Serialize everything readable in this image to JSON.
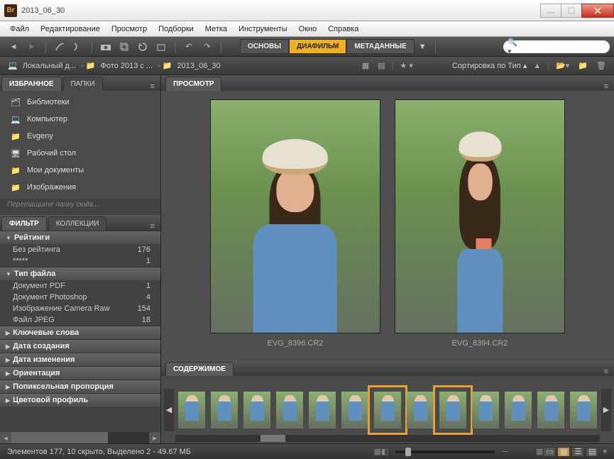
{
  "window": {
    "title": "2013_06_30"
  },
  "menu": [
    "Файл",
    "Редактирование",
    "Просмотр",
    "Подборки",
    "Метка",
    "Инструменты",
    "Окно",
    "Справка"
  ],
  "workspace": {
    "tabs": [
      "ОСНОВЫ",
      "ДИАФИЛЬМ",
      "МЕТАДАННЫЕ"
    ],
    "active": 1
  },
  "search": {
    "placeholder": ""
  },
  "path": {
    "crumbs": [
      "Локальный д...",
      "Фото 2013 с ...",
      "2013_06_30"
    ]
  },
  "sort": {
    "label": "Сортировка по Тип"
  },
  "left": {
    "tabs": {
      "favorites": "ИЗБРАННОЕ",
      "folders": "ПАПКИ"
    },
    "favorites": [
      {
        "label": "Библиотеки",
        "icon": "libraries"
      },
      {
        "label": "Компьютер",
        "icon": "computer"
      },
      {
        "label": "Evgeny",
        "icon": "folder"
      },
      {
        "label": "Рабочий стол",
        "icon": "desktop"
      },
      {
        "label": "Мои документы",
        "icon": "folder"
      },
      {
        "label": "Изображения",
        "icon": "folder"
      }
    ],
    "hint": "Перетащите папку сюда...",
    "filter_tabs": {
      "filter": "ФИЛЬТР",
      "collections": "КОЛЛЕКЦИИ"
    },
    "filter_groups": [
      {
        "name": "Рейтинги",
        "open": true,
        "rows": [
          {
            "label": "Без рейтинга",
            "count": "176"
          },
          {
            "label": "*****",
            "count": "1"
          }
        ]
      },
      {
        "name": "Тип файла",
        "open": true,
        "rows": [
          {
            "label": "Документ PDF",
            "count": "1"
          },
          {
            "label": "Документ Photoshop",
            "count": "4"
          },
          {
            "label": "Изображение Camera Raw",
            "count": "154"
          },
          {
            "label": "Файл JPEG",
            "count": "18"
          }
        ]
      },
      {
        "name": "Ключевые слова",
        "open": false,
        "rows": []
      },
      {
        "name": "Дата создания",
        "open": false,
        "rows": []
      },
      {
        "name": "Дата изменения",
        "open": false,
        "rows": []
      },
      {
        "name": "Ориентация",
        "open": false,
        "rows": []
      },
      {
        "name": "Попиксельная пропорция",
        "open": false,
        "rows": []
      },
      {
        "name": "Цветовой профиль",
        "open": false,
        "rows": []
      }
    ]
  },
  "preview": {
    "tab": "ПРОСМОТР",
    "items": [
      {
        "caption": "EVG_8396.CR2"
      },
      {
        "caption": "EVG_8394.CR2"
      }
    ]
  },
  "content": {
    "tab": "СОДЕРЖИМОЕ",
    "thumb_count": 13,
    "selected": [
      6,
      8
    ]
  },
  "status": {
    "text": "Элементов 177, 10 скрыто, Выделено 2 - 49.67 МБ"
  }
}
